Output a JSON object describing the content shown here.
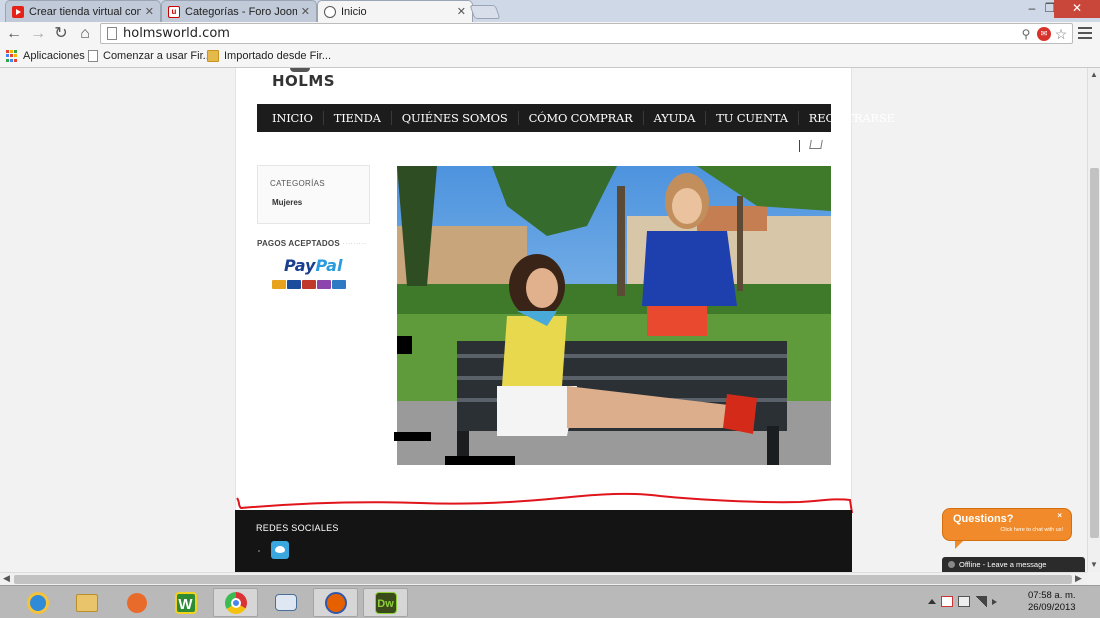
{
  "browser": {
    "tabs": [
      {
        "label": "Crear tienda virtual con Jo",
        "icon": "youtube-icon"
      },
      {
        "label": "Categorías - Foro Joomla!",
        "icon": "joomla-forum-icon"
      },
      {
        "label": "Inicio",
        "icon": "globe-icon",
        "active": true
      }
    ],
    "url": "holmsworld.com",
    "bookmarks": {
      "apps": "Aplicaciones",
      "items": [
        "Comenzar a usar Fir...",
        "Importado desde Fir..."
      ]
    }
  },
  "site": {
    "logo": "HOLMS",
    "nav": [
      "INICIO",
      "TIENDA",
      "QUIÉNES SOMOS",
      "CÓMO COMPRAR",
      "AYUDA",
      "TU CUENTA",
      "REGISTRARSE"
    ],
    "categories": {
      "title": "CATEGORÍAS",
      "items": [
        "Mujeres"
      ]
    },
    "payments": {
      "title": "PAGOS ACEPTADOS",
      "dots": "·········",
      "brand_a": "Pay",
      "brand_b": "Pal"
    },
    "footer": {
      "title": "REDES SOCIALES"
    },
    "colors": {
      "nav_bg": "#1c1c1c",
      "footer_bg": "#141414",
      "chat_orange": "#f08a2a",
      "annotation_red": "#e0141b"
    }
  },
  "chat": {
    "title": "Questions?",
    "subtitle": "Click here to chat with us!",
    "close": "×",
    "status": "Offline - Leave a message"
  },
  "taskbar": {
    "time": "07:58 a. m.",
    "date": "26/09/2013"
  }
}
